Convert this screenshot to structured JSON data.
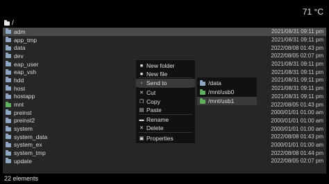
{
  "header": {
    "temperature": "71 °C",
    "path": "/"
  },
  "files": [
    {
      "name": "adm",
      "date": "2021/08/31 09:11 pm",
      "icon": "folder-icon",
      "selected": true
    },
    {
      "name": "app_tmp",
      "date": "2021/08/31 09:11 pm",
      "icon": "folder-icon"
    },
    {
      "name": "data",
      "date": "2022/08/08 01:43 pm",
      "icon": "folder-icon"
    },
    {
      "name": "dev",
      "date": "2022/08/05 02:07 pm",
      "icon": "folder-icon"
    },
    {
      "name": "eap_user",
      "date": "2021/08/31 09:11 pm",
      "icon": "folder-icon"
    },
    {
      "name": "eap_vsh",
      "date": "2021/08/31 09:11 pm",
      "icon": "folder-icon"
    },
    {
      "name": "hdd",
      "date": "2021/08/31 09:11 pm",
      "icon": "folder-icon"
    },
    {
      "name": "host",
      "date": "2021/08/31 09:11 pm",
      "icon": "folder-icon"
    },
    {
      "name": "hostapp",
      "date": "2021/08/31 09:11 pm",
      "icon": "folder-icon"
    },
    {
      "name": "mnt",
      "date": "2022/08/05 01:43 pm",
      "icon": "folder-icon-green"
    },
    {
      "name": "preinst",
      "date": "2000/01/01 01:00 am",
      "icon": "folder-icon"
    },
    {
      "name": "preinst2",
      "date": "2000/01/01 01:00 am",
      "icon": "folder-icon"
    },
    {
      "name": "system",
      "date": "2000/01/01 01:00 am",
      "icon": "folder-icon"
    },
    {
      "name": "system_data",
      "date": "2022/08/08 01:43 pm",
      "icon": "folder-icon"
    },
    {
      "name": "system_ex",
      "date": "2000/01/01 01:00 am",
      "icon": "folder-icon"
    },
    {
      "name": "system_tmp",
      "date": "2022/08/08 01:44 pm",
      "icon": "folder-icon"
    },
    {
      "name": "update",
      "date": "2022/08/05 02:07 pm",
      "icon": "folder-icon"
    }
  ],
  "status": {
    "count": "22 elements"
  },
  "context_menu": {
    "items": [
      {
        "label": "New folder",
        "icon": "folder-icon"
      },
      {
        "label": "New file",
        "icon": "file-icon"
      },
      {
        "label": "Send to",
        "icon": "chevron-right-icon",
        "highlight": true
      },
      {
        "label": "Cut",
        "icon": "cut-icon"
      },
      {
        "label": "Copy",
        "icon": "copy-icon"
      },
      {
        "label": "Paste",
        "icon": "paste-icon"
      },
      {
        "label": "Rename",
        "icon": "rename-icon"
      },
      {
        "label": "Delete",
        "icon": "delete-icon"
      },
      {
        "label": "Properties",
        "icon": "properties-icon"
      }
    ]
  },
  "submenu": {
    "items": [
      {
        "label": "/data",
        "icon": "folder-icon"
      },
      {
        "label": "/mnt/usb0",
        "icon": "folder-icon-green"
      },
      {
        "label": "/mnt/usb1",
        "icon": "folder-icon-green",
        "highlight": true
      }
    ]
  },
  "colors": {
    "background": "#000000",
    "list_bg": "#262626",
    "selected_row": "#4a4a4a",
    "folder": "#8fa8c8",
    "folder_green": "#5db35d"
  }
}
